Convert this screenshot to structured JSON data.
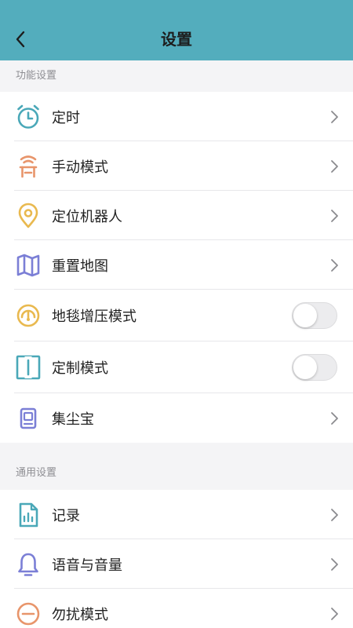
{
  "header": {
    "title": "设置",
    "back_icon": "chevron-left-icon",
    "background_color": "#53adbd"
  },
  "sections": [
    {
      "title": "功能设置",
      "items": [
        {
          "label": "定时",
          "icon": "alarm-clock-icon",
          "icon_color": "#4aa8b8",
          "control": "chevron"
        },
        {
          "label": "手动模式",
          "icon": "remote-control-icon",
          "icon_color": "#e8956b",
          "control": "chevron"
        },
        {
          "label": "定位机器人",
          "icon": "location-pin-icon",
          "icon_color": "#e9b94f",
          "control": "chevron"
        },
        {
          "label": "重置地图",
          "icon": "map-icon",
          "icon_color": "#7b7fd6",
          "control": "chevron"
        },
        {
          "label": "地毯增压模式",
          "icon": "gauge-icon",
          "icon_color": "#e9b94f",
          "control": "toggle",
          "value": false
        },
        {
          "label": "定制模式",
          "icon": "custom-mode-icon",
          "icon_color": "#4aa8b8",
          "control": "toggle",
          "value": false
        },
        {
          "label": "集尘宝",
          "icon": "dust-box-icon",
          "icon_color": "#7b7fd6",
          "control": "chevron"
        }
      ]
    },
    {
      "title": "通用设置",
      "items": [
        {
          "label": "记录",
          "icon": "record-document-icon",
          "icon_color": "#4aa8b8",
          "control": "chevron"
        },
        {
          "label": "语音与音量",
          "icon": "bell-icon",
          "icon_color": "#7b7fd6",
          "control": "chevron"
        },
        {
          "label": "勿扰模式",
          "icon": "do-not-disturb-icon",
          "icon_color": "#e8956b",
          "control": "chevron"
        }
      ]
    }
  ]
}
